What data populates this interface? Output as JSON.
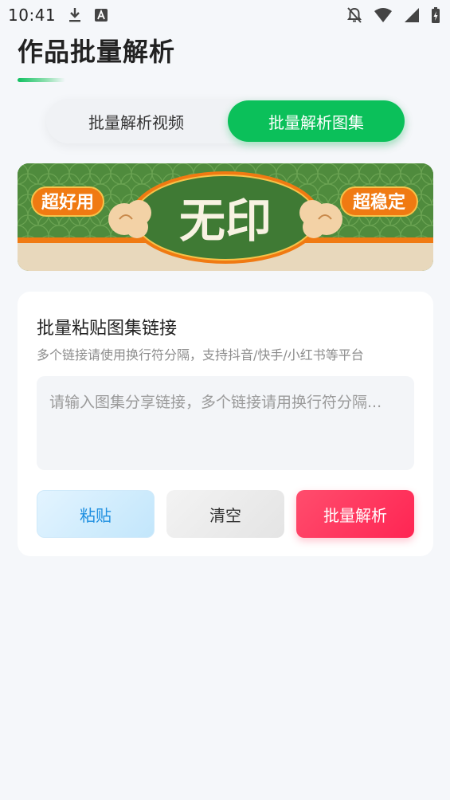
{
  "status_bar": {
    "time": "10:41",
    "icons": [
      "download-icon",
      "text-a-icon",
      "notifications-off-icon",
      "wifi-icon",
      "cellular-signal-icon",
      "battery-charging-icon"
    ]
  },
  "page": {
    "title": "作品批量解析"
  },
  "tabs": [
    {
      "label": "批量解析视频",
      "active": false
    },
    {
      "label": "批量解析图集",
      "active": true
    }
  ],
  "banner": {
    "left_badge": "超好用",
    "center_text": "无印",
    "right_badge": "超稳定"
  },
  "card": {
    "title": "批量粘贴图集链接",
    "subtitle": "多个链接请使用换行符分隔，支持抖音/快手/小红书等平台",
    "input_placeholder": "请输入图集分享链接，多个链接请用换行符分隔...",
    "input_value": ""
  },
  "buttons": {
    "paste": "粘贴",
    "clear": "清空",
    "parse": "批量解析"
  },
  "colors": {
    "accent_green": "#0bc05a",
    "primary_red": "#ff2553",
    "paste_blue": "#1e8fe0",
    "background": "#f5f7fa"
  }
}
